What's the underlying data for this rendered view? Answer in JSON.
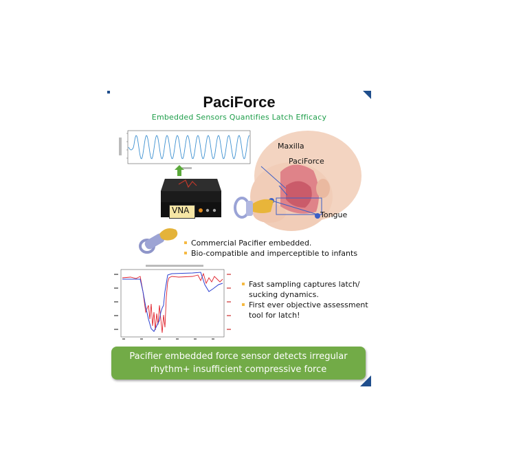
{
  "slide": {
    "title": "PaciForce",
    "subtitle": "Embedded Sensors Quantifies Latch Efficacy"
  },
  "labels": {
    "vna": "VNA",
    "maxilla": "Maxilla",
    "paciforce": "PaciForce",
    "tongue": "Tongue"
  },
  "bullets_top": [
    "Commercial Pacifier embedded.",
    "Bio-compatible and imperceptible to infants"
  ],
  "bullets_right": [
    "Fast sampling captures latch/",
    "sucking dynamics.",
    "First ever objective assessment",
    "tool for latch!"
  ],
  "banner": {
    "line1": "Pacifier embedded force sensor detects irregular",
    "line2": "rhythm+ insufficient compressive force"
  },
  "colors": {
    "accent_green": "#1e9e4a",
    "banner_green": "#72ab47",
    "corner_blue": "#1f4e8c",
    "bullet_orange": "#f5b942",
    "signal_blue": "#3b8fd0",
    "trace_red": "#e0202a",
    "trace_blue": "#2a3fd0"
  },
  "icons": [
    "arrow-up-icon",
    "pacifier-icon",
    "infant-head-icon",
    "vna-device-icon"
  ]
}
